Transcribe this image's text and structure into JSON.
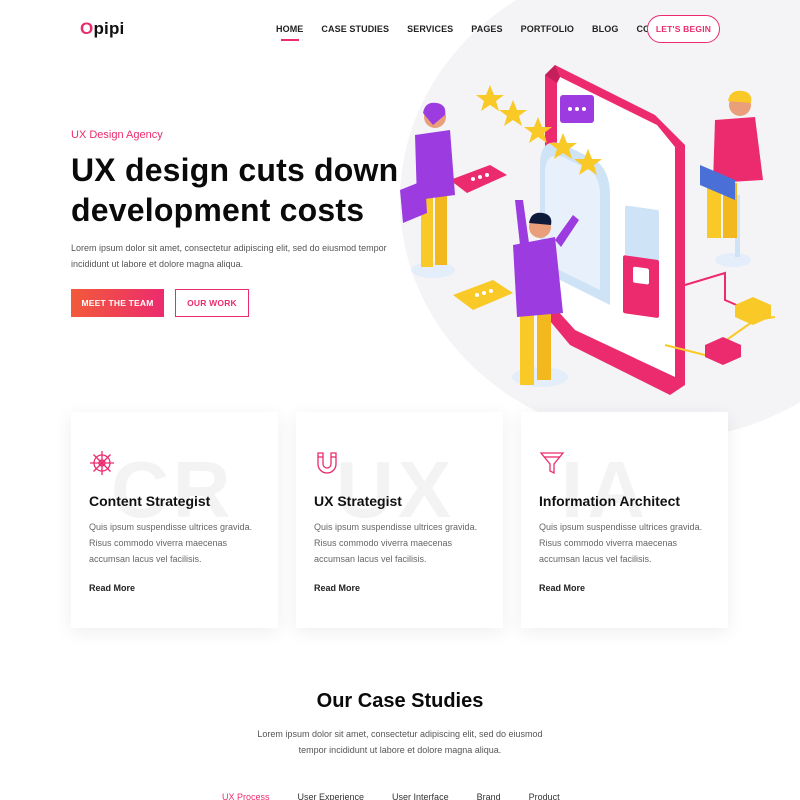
{
  "brand": {
    "logo_first": "O",
    "logo_rest": "pipi",
    "accent": "#ec2b6e"
  },
  "nav": {
    "items": [
      "HOME",
      "CASE STUDIES",
      "SERVICES",
      "PAGES",
      "PORTFOLIO",
      "BLOG",
      "CONTACT"
    ],
    "active": "HOME",
    "cta": "LET'S BEGIN"
  },
  "hero": {
    "tag": "UX Design Agency",
    "title": "UX design cuts down development costs",
    "desc": "Lorem ipsum dolor sit amet, consectetur adipiscing elit, sed do eiusmod tempor incididunt ut labore et dolore magna aliqua.",
    "primary_button": "MEET THE TEAM",
    "secondary_button": "OUR WORK"
  },
  "cards": [
    {
      "watermark": "CR",
      "icon": "ship-wheel-icon",
      "title": "Content Strategist",
      "desc": "Quis ipsum suspendisse ultrices gravida. Risus commodo viverra maecenas accumsan lacus vel facilisis.",
      "more": "Read More"
    },
    {
      "watermark": "UX",
      "icon": "magnet-icon",
      "title": "UX Strategist",
      "desc": "Quis ipsum suspendisse ultrices gravida. Risus commodo viverra maecenas accumsan lacus vel facilisis.",
      "more": "Read More"
    },
    {
      "watermark": "IA",
      "icon": "funnel-icon",
      "title": "Information Architect",
      "desc": "Quis ipsum suspendisse ultrices gravida. Risus commodo viverra maecenas accumsan lacus vel facilisis.",
      "more": "Read More"
    }
  ],
  "case_studies": {
    "title": "Our Case Studies",
    "desc": "Lorem ipsum dolor sit amet, consectetur adipiscing elit, sed do eiusmod tempor incididunt ut labore et dolore magna aliqua.",
    "tabs": [
      "UX Process",
      "User Experience",
      "User Interface",
      "Brand",
      "Product"
    ],
    "active_tab": "UX Process"
  }
}
